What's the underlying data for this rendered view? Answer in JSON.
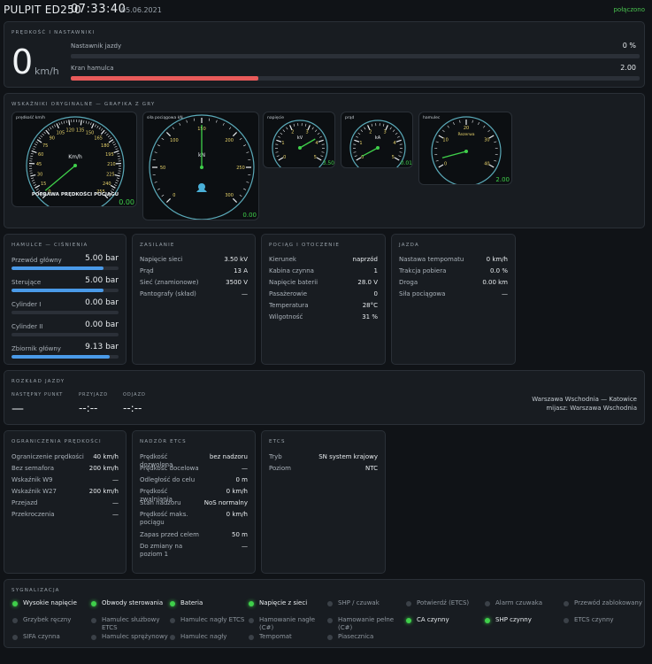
{
  "header": {
    "title": "PULPIT ED250",
    "time": "07:33:40",
    "date": "05.06.2021",
    "status": "połączono"
  },
  "speed": {
    "title": "PRĘDKOŚĆ I NASTAWNIKI",
    "value": "0",
    "unit": "km/h",
    "controller_label": "Nastawnik jazdy",
    "controller_value": "0 %",
    "controller_level": 0,
    "brake_label": "Kran hamulca",
    "brake_value": "2.00",
    "brake_level": 0.33
  },
  "gauges": {
    "title": "WSKAŹNIKI ORYGINALNE — GRAFIKA Z GRY",
    "speedo": {
      "caption": "prędkość km/h",
      "unit": "Km/h",
      "ticks": [
        "0",
        "15",
        "30",
        "45",
        "60",
        "75",
        "90",
        "105",
        "120",
        "135",
        "150",
        "165",
        "180",
        "195",
        "210",
        "225",
        "240",
        "255"
      ],
      "banner": "POPRAWA PRĘDKOŚCI POCIĄGU",
      "readout": "0.00"
    },
    "power": {
      "caption": "siła pociągowa kN",
      "unit": "kN",
      "ticks": [
        "0",
        "50",
        "100",
        "150",
        "200",
        "250",
        "300"
      ],
      "readout": "0.00"
    },
    "kv": {
      "caption": "napięcie",
      "unit": "kV",
      "ticks": [
        "0",
        "1",
        "2",
        "3",
        "4",
        "5"
      ],
      "readout": "3.50"
    },
    "ka": {
      "caption": "prąd",
      "unit": "kA",
      "ticks": [
        "0",
        "1",
        "2",
        "3",
        "4",
        "5"
      ],
      "readout": "0.01"
    },
    "brake": {
      "caption": "hamulec",
      "unit": "Rezerwa",
      "ticks": [
        "0",
        "10",
        "20",
        "30",
        "40"
      ],
      "readout": "2.00"
    }
  },
  "brakes": {
    "title": "HAMULCE — CIŚNIENIA",
    "items": [
      {
        "label": "Przewód główny",
        "value": "5.00 bar",
        "level": 0.86
      },
      {
        "label": "Sterujące",
        "value": "5.00 bar",
        "level": 0.86
      },
      {
        "label": "Cylinder I",
        "value": "0.00 bar",
        "level": 0
      },
      {
        "label": "Cylinder II",
        "value": "0.00 bar",
        "level": 0
      },
      {
        "label": "Zbiornik główny",
        "value": "9.13 bar",
        "level": 0.92
      }
    ]
  },
  "supply": {
    "title": "ZASILANIE",
    "rows": [
      {
        "label": "Napięcie sieci",
        "value": "3.50 kV"
      },
      {
        "label": "Prąd",
        "value": "13 A"
      },
      {
        "label": "Sieć (znamionowe)",
        "value": "3500 V"
      },
      {
        "label": "Pantografy (skład)",
        "value": "—"
      }
    ]
  },
  "train": {
    "title": "POCIĄG I OTOCZENIE",
    "rows": [
      {
        "label": "Kierunek",
        "value": "naprzód"
      },
      {
        "label": "Kabina czynna",
        "value": "1"
      },
      {
        "label": "Napięcie baterii",
        "value": "28.0 V"
      },
      {
        "label": "Pasażerowie",
        "value": "0"
      },
      {
        "label": "Temperatura",
        "value": "28°C"
      },
      {
        "label": "Wilgotność",
        "value": "31 %"
      }
    ]
  },
  "drive": {
    "title": "JAZDA",
    "rows": [
      {
        "label": "Nastawa tempomatu",
        "value": "0 km/h"
      },
      {
        "label": "Trakcja pobiera",
        "value": "0.0 %"
      },
      {
        "label": "Droga",
        "value": "0.00 km"
      },
      {
        "label": "Siła pociągowa",
        "value": "—"
      }
    ]
  },
  "timetable": {
    "title": "ROZKŁAD JAZDY",
    "next_label": "NASTĘPNY PUNKT",
    "next_value": "—",
    "arr_label": "PRZYJAZD",
    "arr_value": "--:--",
    "dep_label": "ODJAZD",
    "dep_value": "--:--",
    "route": "Warszawa Wschodnia — Katowice",
    "location": "mijasz: Warszawa Wschodnia"
  },
  "limits": {
    "title": "OGRANICZENIA PRĘDKOŚCI",
    "rows": [
      {
        "label": "Ograniczenie prędkości",
        "value": "40 km/h"
      },
      {
        "label": "Bez semafora",
        "value": "200 km/h"
      },
      {
        "label": "Wskaźnik W9",
        "value": "—"
      },
      {
        "label": "Wskaźnik W27",
        "value": "200 km/h"
      },
      {
        "label": "Przejazd",
        "value": "—"
      },
      {
        "label": "Przekroczenia",
        "value": "—"
      }
    ]
  },
  "etcs_sup": {
    "title": "NADZÓR ETCS",
    "rows": [
      {
        "label": "Prędkość dozwolona",
        "value": "bez nadzoru"
      },
      {
        "label": "Prędkość docelowa",
        "value": "—"
      },
      {
        "label": "Odległość do celu",
        "value": "0 m"
      },
      {
        "label": "Prędkość zwalniania",
        "value": "0 km/h"
      },
      {
        "label": "Stan nadzoru",
        "value": "NoS normalny"
      },
      {
        "label": "Prędkość maks. pociągu",
        "value": "0 km/h"
      },
      {
        "label": "Zapas przed celem",
        "value": "50 m"
      },
      {
        "label": "Do zmiany na poziom 1",
        "value": "—"
      }
    ]
  },
  "etcs": {
    "title": "ETCS",
    "rows": [
      {
        "label": "Tryb",
        "value": "SN system krajowy"
      },
      {
        "label": "Poziom",
        "value": "NTC"
      }
    ]
  },
  "signals": {
    "title": "SYGNALIZACJA",
    "items": [
      {
        "label": "Wysokie napięcie",
        "on": true
      },
      {
        "label": "Obwody sterowania",
        "on": true
      },
      {
        "label": "Bateria",
        "on": true
      },
      {
        "label": "Napięcie z sieci",
        "on": true
      },
      {
        "label": "SHP / czuwak",
        "on": false
      },
      {
        "label": "Potwierdź (ETCS)",
        "on": false
      },
      {
        "label": "Alarm czuwaka",
        "on": false
      },
      {
        "label": "Przewód zablokowany",
        "on": false
      },
      {
        "label": "Grzybek ręczny",
        "on": false
      },
      {
        "label": "Hamulec służbowy ETCS",
        "on": false
      },
      {
        "label": "Hamulec nagły ETCS",
        "on": false
      },
      {
        "label": "Hamowanie nagłe (C#)",
        "on": false
      },
      {
        "label": "Hamowanie pełne (C#)",
        "on": false
      },
      {
        "label": "CA czynny",
        "on": true
      },
      {
        "label": "SHP czynny",
        "on": true
      },
      {
        "label": "ETCS czynny",
        "on": false
      },
      {
        "label": "SIFA czynna",
        "on": false
      },
      {
        "label": "Hamulec sprężynowy",
        "on": false
      },
      {
        "label": "Hamulec nagły",
        "on": false
      },
      {
        "label": "Tempomat",
        "on": false
      },
      {
        "label": "Piasecznica",
        "on": false
      }
    ]
  },
  "colors": {
    "accent": "#4a9ae8",
    "brake_bar": "#e85a5a",
    "ok": "#3fcf4a",
    "needle": "#3fcf4a"
  }
}
